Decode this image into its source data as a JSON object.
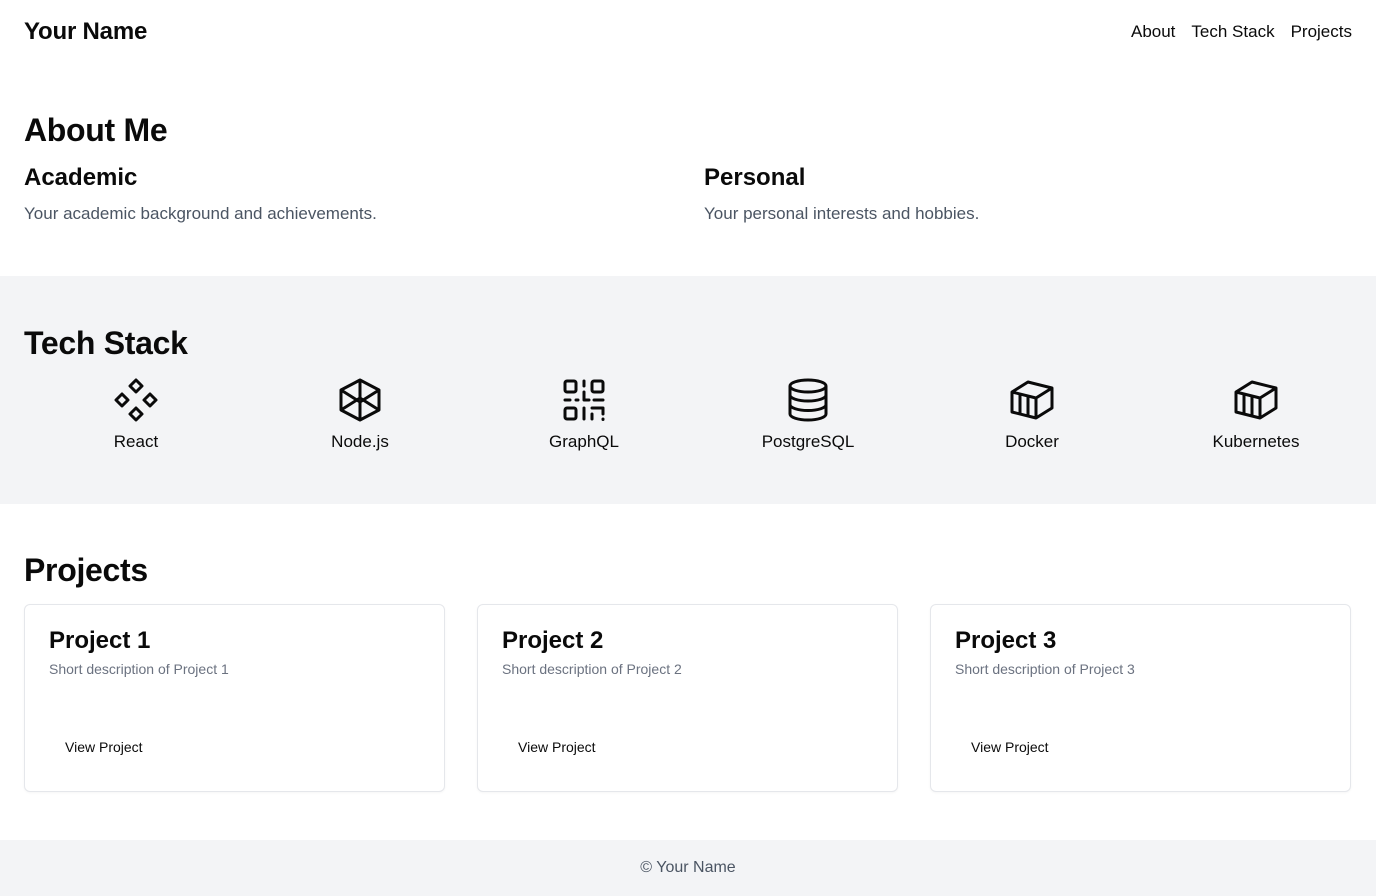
{
  "header": {
    "brand": "Your Name",
    "nav": [
      {
        "label": "About"
      },
      {
        "label": "Tech Stack"
      },
      {
        "label": "Projects"
      }
    ]
  },
  "about": {
    "title": "About Me",
    "academic": {
      "heading": "Academic",
      "text": "Your academic background and achievements."
    },
    "personal": {
      "heading": "Personal",
      "text": "Your personal interests and hobbies."
    }
  },
  "tech_stack": {
    "title": "Tech Stack",
    "items": [
      {
        "label": "React",
        "icon": "diamonds-icon"
      },
      {
        "label": "Node.js",
        "icon": "codepen-icon"
      },
      {
        "label": "GraphQL",
        "icon": "qrcode-icon"
      },
      {
        "label": "PostgreSQL",
        "icon": "database-icon"
      },
      {
        "label": "Docker",
        "icon": "container-icon"
      },
      {
        "label": "Kubernetes",
        "icon": "container-icon"
      }
    ]
  },
  "projects": {
    "title": "Projects",
    "items": [
      {
        "title": "Project 1",
        "description": "Short description of Project 1",
        "button": "View Project"
      },
      {
        "title": "Project 2",
        "description": "Short description of Project 2",
        "button": "View Project"
      },
      {
        "title": "Project 3",
        "description": "Short description of Project 3",
        "button": "View Project"
      }
    ]
  },
  "footer": {
    "text": "© Your Name"
  },
  "colors": {
    "text": "#0a0a0a",
    "muted": "#4b5563",
    "subtle": "#6b7280",
    "section_bg": "#f3f4f6",
    "border": "#e5e7eb"
  }
}
